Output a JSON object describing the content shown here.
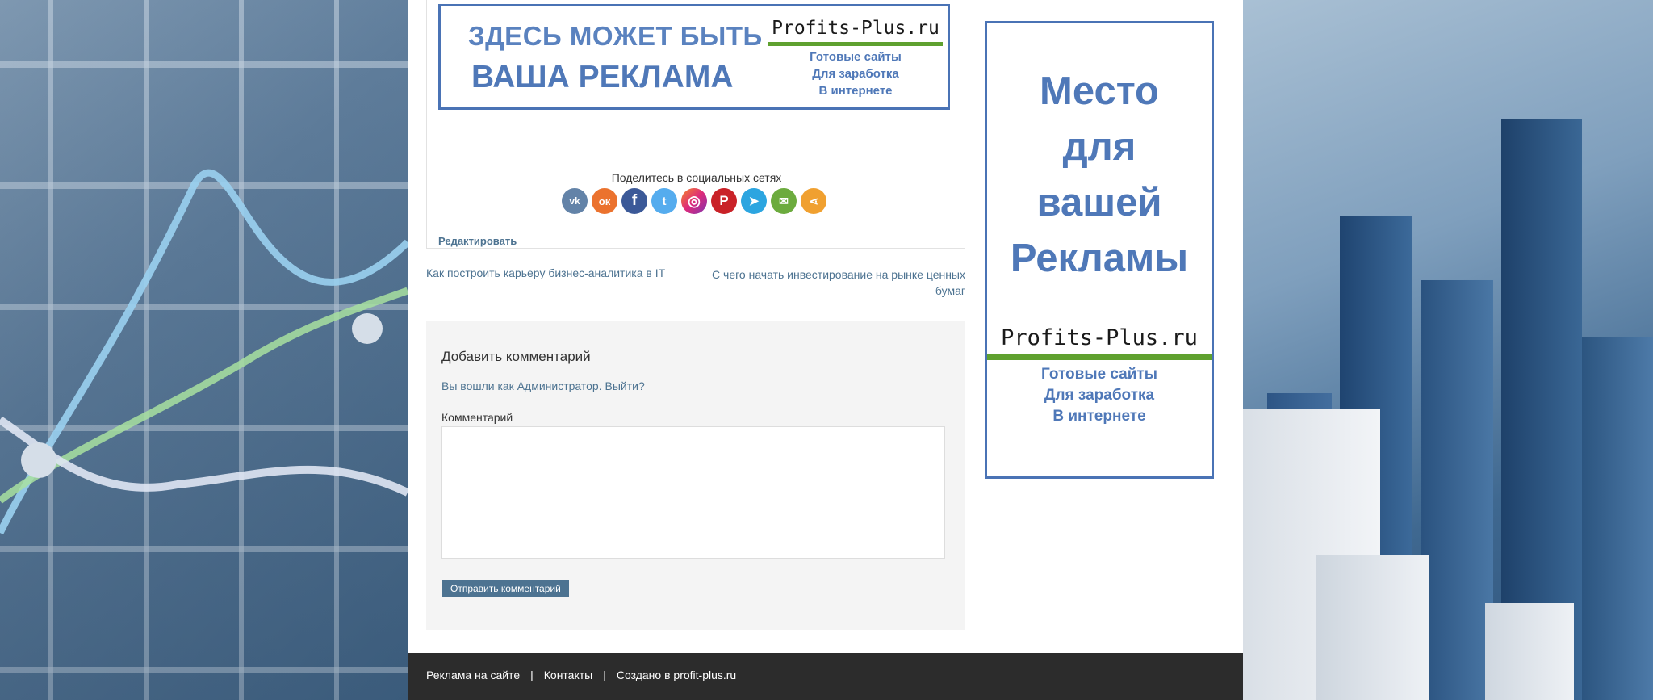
{
  "banner": {
    "line1": "ЗДЕСЬ МОЖЕТ БЫТЬ",
    "line2": "ВАША РЕКЛАМА",
    "brand": "Profits-Plus.ru",
    "tagline": [
      "Готовые сайты",
      "Для заработка",
      "В интернете"
    ]
  },
  "share": {
    "title": "Поделитесь в социальных сетях",
    "buttons": [
      {
        "name": "vk",
        "glyph": "vk",
        "color": "#6383a8"
      },
      {
        "name": "odnoklassniki",
        "glyph": "ок",
        "color": "#eb722e"
      },
      {
        "name": "facebook",
        "glyph": "f",
        "color": "#3b5998"
      },
      {
        "name": "twitter",
        "glyph": "t",
        "color": "#55acee"
      },
      {
        "name": "instagram",
        "glyph": "◎",
        "color": "#c13584"
      },
      {
        "name": "pinterest",
        "glyph": "P",
        "color": "#c92228"
      },
      {
        "name": "telegram",
        "glyph": "➤",
        "color": "#2ca5e0"
      },
      {
        "name": "email",
        "glyph": "✉",
        "color": "#6cab3e"
      },
      {
        "name": "more",
        "glyph": "⋖",
        "color": "#f0a030"
      }
    ]
  },
  "edit_link": "Редактировать",
  "post_nav": {
    "prev": "Как построить карьеру бизнес-аналитика в IT",
    "next": "С чего начать инвестирование на рынке ценных бумаг"
  },
  "comments": {
    "title": "Добавить комментарий",
    "logged_in_text": "Вы вошли как Администратор. Выйти?",
    "label": "Комментарий",
    "textarea_value": "",
    "submit_label": "Отправить комментарий"
  },
  "sidebar_ad": {
    "words": [
      "Место",
      "для",
      "вашей",
      "Рекламы"
    ],
    "brand": "Profits-Plus.ru",
    "tagline": [
      "Готовые сайты",
      "Для заработка",
      "В интернете"
    ]
  },
  "footer": {
    "links": [
      "Реклама на сайте",
      "Контакты",
      "Создано в profit-plus.ru"
    ],
    "separator": "|"
  },
  "colors": {
    "accent": "#4d7391",
    "ad_blue": "#4f78b8",
    "brand_green": "#5fa12f",
    "footer_bg": "#2c2c2c"
  }
}
